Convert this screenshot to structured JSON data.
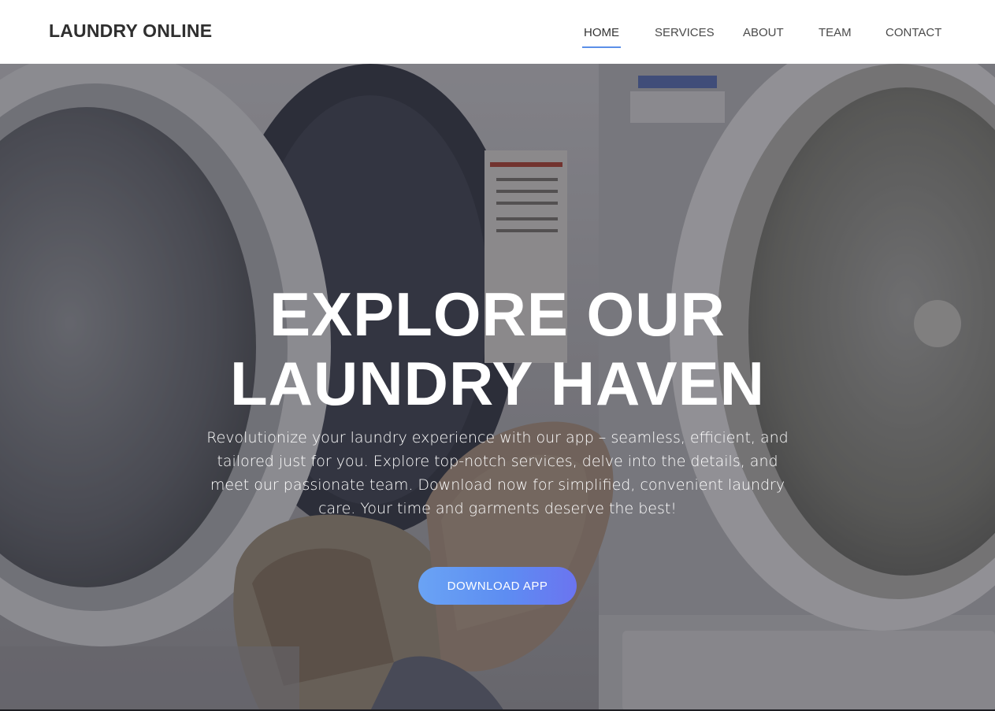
{
  "header": {
    "brand": "LAUNDRY ONLINE",
    "nav": [
      {
        "label": "HOME",
        "active": true
      },
      {
        "label": "SERVICES",
        "active": false
      },
      {
        "label": "ABOUT",
        "active": false
      },
      {
        "label": "TEAM",
        "active": false
      },
      {
        "label": "CONTACT",
        "active": false
      }
    ]
  },
  "hero": {
    "title_line1": "EXPLORE OUR",
    "title_line2": "LAUNDRY HAVEN",
    "description": "Revolutionize your laundry experience with our app – seamless, efficient, and tailored just for you. Explore top-notch services, delve into the details, and meet our passionate team. Download now for simplified, convenient laundry care. Your time and garments deserve the best!",
    "cta_label": "DOWNLOAD APP"
  },
  "colors": {
    "accent": "#5b8fe8",
    "button_gradient_start": "#6aa3f4",
    "button_gradient_end": "#6b74f0"
  }
}
